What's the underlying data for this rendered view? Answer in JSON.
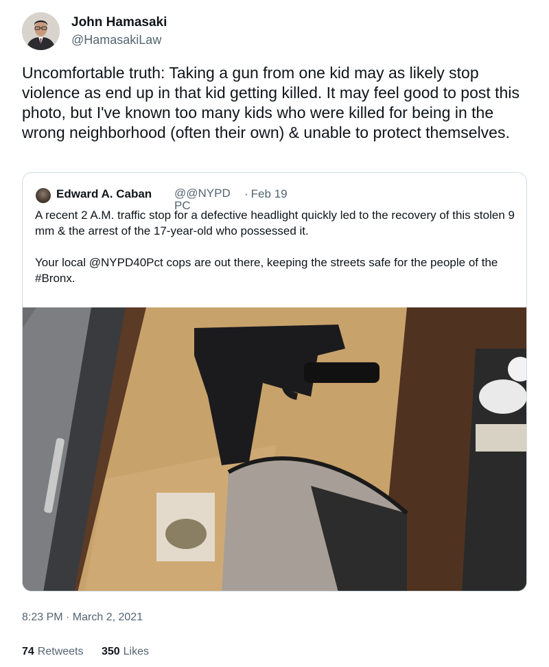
{
  "author": {
    "name": "John Hamasaki",
    "handle": "@HamasakiLaw"
  },
  "tweet": {
    "text": "Uncomfortable truth: Taking a gun from one kid may as likely stop violence as end up in that kid getting killed. It may feel good to post this photo, but I've known too many kids who were killed for being in the wrong neighborhood (often their own) & unable to protect themselves."
  },
  "quoted_tweet": {
    "author_name": "Edward A. Caban",
    "author_handle": "@@NYPDPC",
    "date_separator": "·",
    "date": "Feb 19",
    "paragraph_1": "A recent 2 A.M. traffic stop for a defective headlight quickly led to the recovery of this stolen 9 mm & the arrest of the 17-year-old who possessed it.",
    "paragraph_2": "Your local @NYPD40Pct cops are out there, keeping the streets safe for  the people of the #Bronx."
  },
  "meta": {
    "timestamp": "8:23 PM · March 2, 2021",
    "retweets_count": "74",
    "retweets_label": "Retweets",
    "likes_count": "350",
    "likes_label": "Likes"
  },
  "icons": {
    "author_avatar": "avatar-photo",
    "quoted_avatar": "avatar-photo"
  },
  "colors": {
    "text_primary": "#0f1419",
    "text_secondary": "#536471",
    "border": "#cfd9de"
  }
}
